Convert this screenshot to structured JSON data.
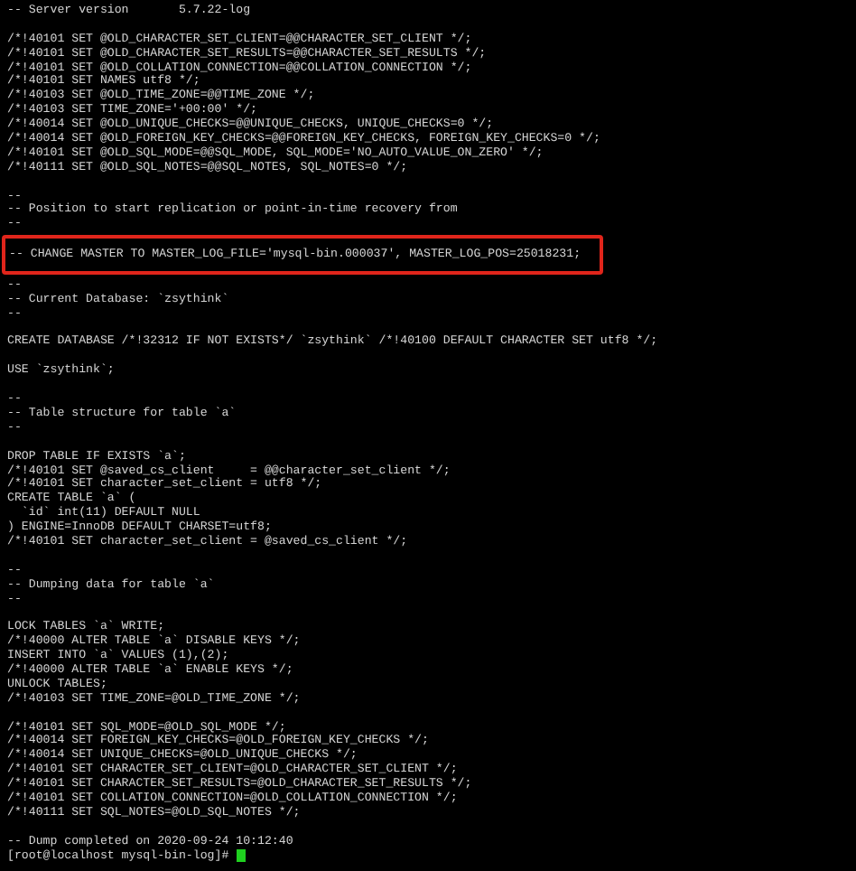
{
  "terminal": {
    "lines": [
      {
        "kind": "text",
        "text": "-- Server version\t5.7.22-log"
      },
      {
        "kind": "blank"
      },
      {
        "kind": "text",
        "text": "/*!40101 SET @OLD_CHARACTER_SET_CLIENT=@@CHARACTER_SET_CLIENT */;"
      },
      {
        "kind": "text",
        "text": "/*!40101 SET @OLD_CHARACTER_SET_RESULTS=@@CHARACTER_SET_RESULTS */;"
      },
      {
        "kind": "text",
        "text": "/*!40101 SET @OLD_COLLATION_CONNECTION=@@COLLATION_CONNECTION */;"
      },
      {
        "kind": "text",
        "text": "/*!40101 SET NAMES utf8 */;"
      },
      {
        "kind": "text",
        "text": "/*!40103 SET @OLD_TIME_ZONE=@@TIME_ZONE */;"
      },
      {
        "kind": "text",
        "text": "/*!40103 SET TIME_ZONE='+00:00' */;"
      },
      {
        "kind": "text",
        "text": "/*!40014 SET @OLD_UNIQUE_CHECKS=@@UNIQUE_CHECKS, UNIQUE_CHECKS=0 */;"
      },
      {
        "kind": "text",
        "text": "/*!40014 SET @OLD_FOREIGN_KEY_CHECKS=@@FOREIGN_KEY_CHECKS, FOREIGN_KEY_CHECKS=0 */;"
      },
      {
        "kind": "text",
        "text": "/*!40101 SET @OLD_SQL_MODE=@@SQL_MODE, SQL_MODE='NO_AUTO_VALUE_ON_ZERO' */;"
      },
      {
        "kind": "text",
        "text": "/*!40111 SET @OLD_SQL_NOTES=@@SQL_NOTES, SQL_NOTES=0 */;"
      },
      {
        "kind": "blank"
      },
      {
        "kind": "text",
        "text": "--"
      },
      {
        "kind": "text",
        "text": "-- Position to start replication or point-in-time recovery from"
      },
      {
        "kind": "text",
        "text": "--"
      },
      {
        "kind": "blank"
      },
      {
        "kind": "highlight",
        "text": "-- CHANGE MASTER TO MASTER_LOG_FILE='mysql-bin.000037', MASTER_LOG_POS=25018231;"
      },
      {
        "kind": "blank"
      },
      {
        "kind": "text",
        "text": "--"
      },
      {
        "kind": "text",
        "text": "-- Current Database: `zsythink`"
      },
      {
        "kind": "text",
        "text": "--"
      },
      {
        "kind": "blank"
      },
      {
        "kind": "text",
        "text": "CREATE DATABASE /*!32312 IF NOT EXISTS*/ `zsythink` /*!40100 DEFAULT CHARACTER SET utf8 */;"
      },
      {
        "kind": "blank"
      },
      {
        "kind": "text",
        "text": "USE `zsythink`;"
      },
      {
        "kind": "blank"
      },
      {
        "kind": "text",
        "text": "--"
      },
      {
        "kind": "text",
        "text": "-- Table structure for table `a`"
      },
      {
        "kind": "text",
        "text": "--"
      },
      {
        "kind": "blank"
      },
      {
        "kind": "text",
        "text": "DROP TABLE IF EXISTS `a`;"
      },
      {
        "kind": "text",
        "text": "/*!40101 SET @saved_cs_client     = @@character_set_client */;"
      },
      {
        "kind": "text",
        "text": "/*!40101 SET character_set_client = utf8 */;"
      },
      {
        "kind": "text",
        "text": "CREATE TABLE `a` ("
      },
      {
        "kind": "text",
        "text": "  `id` int(11) DEFAULT NULL"
      },
      {
        "kind": "text",
        "text": ") ENGINE=InnoDB DEFAULT CHARSET=utf8;"
      },
      {
        "kind": "text",
        "text": "/*!40101 SET character_set_client = @saved_cs_client */;"
      },
      {
        "kind": "blank"
      },
      {
        "kind": "text",
        "text": "--"
      },
      {
        "kind": "text",
        "text": "-- Dumping data for table `a`"
      },
      {
        "kind": "text",
        "text": "--"
      },
      {
        "kind": "blank"
      },
      {
        "kind": "text",
        "text": "LOCK TABLES `a` WRITE;"
      },
      {
        "kind": "text",
        "text": "/*!40000 ALTER TABLE `a` DISABLE KEYS */;"
      },
      {
        "kind": "text",
        "text": "INSERT INTO `a` VALUES (1),(2);"
      },
      {
        "kind": "text",
        "text": "/*!40000 ALTER TABLE `a` ENABLE KEYS */;"
      },
      {
        "kind": "text",
        "text": "UNLOCK TABLES;"
      },
      {
        "kind": "text",
        "text": "/*!40103 SET TIME_ZONE=@OLD_TIME_ZONE */;"
      },
      {
        "kind": "blank"
      },
      {
        "kind": "text",
        "text": "/*!40101 SET SQL_MODE=@OLD_SQL_MODE */;"
      },
      {
        "kind": "text",
        "text": "/*!40014 SET FOREIGN_KEY_CHECKS=@OLD_FOREIGN_KEY_CHECKS */;"
      },
      {
        "kind": "text",
        "text": "/*!40014 SET UNIQUE_CHECKS=@OLD_UNIQUE_CHECKS */;"
      },
      {
        "kind": "text",
        "text": "/*!40101 SET CHARACTER_SET_CLIENT=@OLD_CHARACTER_SET_CLIENT */;"
      },
      {
        "kind": "text",
        "text": "/*!40101 SET CHARACTER_SET_RESULTS=@OLD_CHARACTER_SET_RESULTS */;"
      },
      {
        "kind": "text",
        "text": "/*!40101 SET COLLATION_CONNECTION=@OLD_COLLATION_CONNECTION */;"
      },
      {
        "kind": "text",
        "text": "/*!40111 SET SQL_NOTES=@OLD_SQL_NOTES */;"
      },
      {
        "kind": "blank"
      },
      {
        "kind": "text",
        "text": "-- Dump completed on 2020-09-24 10:12:40"
      },
      {
        "kind": "prompt",
        "text": "[root@localhost mysql-bin-log]#"
      }
    ]
  }
}
